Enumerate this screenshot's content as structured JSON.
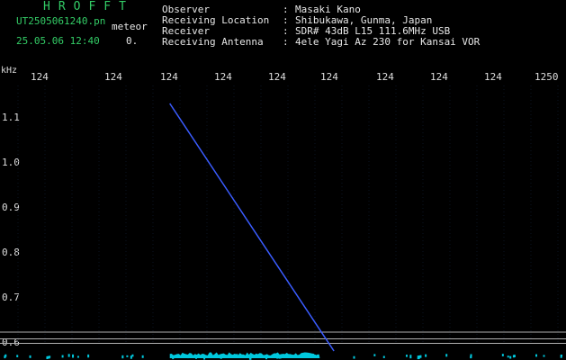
{
  "header": {
    "brand": "HROFFT",
    "filename": "UT2505061240.pn",
    "meteor_label": "meteor",
    "datetime": "25.05.06 12:40",
    "count": "0."
  },
  "info": [
    {
      "key": "Observer",
      "value": "Masaki Kano"
    },
    {
      "key": "Receiving Location",
      "value": "Shibukawa, Gunma, Japan"
    },
    {
      "key": "Receiver",
      "value": "SDR# 43dB L15 111.6MHz USB"
    },
    {
      "key": "Receiving Antenna",
      "value": "4ele Yagi Az 230 for Kansai VOR"
    }
  ],
  "colon": ":",
  "chart_data": {
    "type": "line",
    "ylabel": "kHz",
    "x_ticks": [
      "124",
      "124",
      "124",
      "124",
      "124",
      "124",
      "124",
      "124",
      "124",
      "1250"
    ],
    "y_ticks": [
      "1.1",
      "1.0",
      "0.9",
      "0.8",
      "0.7",
      "0.6"
    ],
    "ylim": [
      0.58,
      1.13
    ],
    "series": [
      {
        "color": "#3a5cff",
        "x": [
          0.3,
          0.59
        ],
        "y": [
          1.13,
          0.58
        ]
      }
    ],
    "noise_color": "#00c8dd",
    "noise_level": 0.6,
    "guide_lines": [
      0.622,
      0.607,
      0.597
    ],
    "guide_color": "#b0b0b0",
    "background": "#000000"
  }
}
